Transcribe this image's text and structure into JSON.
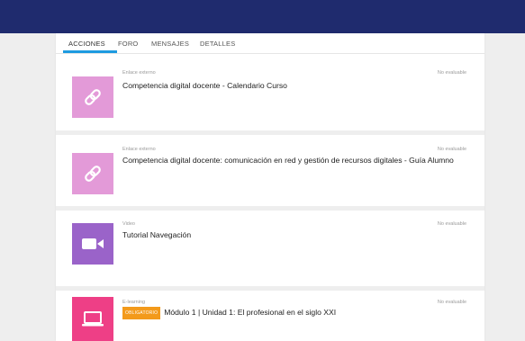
{
  "tabs": [
    {
      "label": "ACCIONES",
      "active": true
    },
    {
      "label": "FORO",
      "active": false
    },
    {
      "label": "MENSAJES",
      "active": false
    },
    {
      "label": "DETALLES",
      "active": false
    }
  ],
  "colors": {
    "header": "#1f2b6e",
    "accent": "#1e9be0",
    "link_tile": "#e39ad8",
    "video_tile": "#9a63c9",
    "elearning_tile": "#ee3f86",
    "badge": "#f39a1b"
  },
  "items": [
    {
      "type": "Enlace externo",
      "status": "No evaluable",
      "icon": "link-icon",
      "title": "Competencia digital docente - Calendario Curso"
    },
    {
      "type": "Enlace externo",
      "status": "No evaluable",
      "icon": "link-icon",
      "title": "Competencia digital docente: comunicación en red y gestión de recursos digitales - Guía Alumno"
    },
    {
      "type": "Video",
      "status": "No evaluable",
      "icon": "video-camera-icon",
      "title": "Tutorial Navegación"
    },
    {
      "type": "E-learning",
      "status": "No evaluable",
      "icon": "laptop-icon",
      "badge": "OBLIGATORIO",
      "title": "Módulo 1 | Unidad 1: El profesional en el siglo XXI"
    }
  ]
}
